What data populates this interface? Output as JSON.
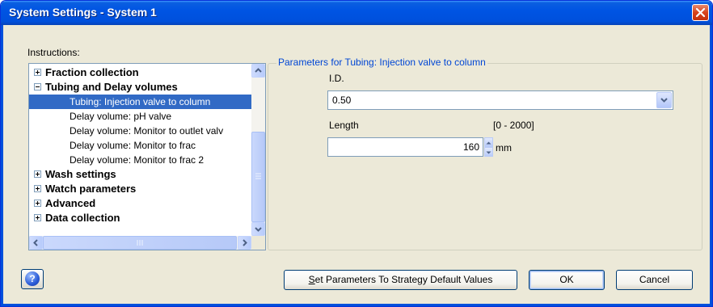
{
  "window": {
    "title": "System Settings - System 1"
  },
  "instructions_label": "Instructions:",
  "tree": {
    "items": [
      {
        "label": "Fraction collection",
        "level": 0,
        "toggle": "plus"
      },
      {
        "label": "Tubing and Delay volumes",
        "level": 0,
        "toggle": "minus"
      },
      {
        "label": "Tubing: Injection valve to column",
        "level": 1,
        "selected": true
      },
      {
        "label": "Delay volume: pH valve",
        "level": 1
      },
      {
        "label": "Delay volume: Monitor to outlet valv",
        "level": 1
      },
      {
        "label": "Delay volume: Monitor to frac",
        "level": 1
      },
      {
        "label": "Delay volume: Monitor to frac 2",
        "level": 1
      },
      {
        "label": "Wash settings",
        "level": 0,
        "toggle": "plus"
      },
      {
        "label": "Watch parameters",
        "level": 0,
        "toggle": "plus"
      },
      {
        "label": "Advanced",
        "level": 0,
        "toggle": "plus"
      },
      {
        "label": "Data collection",
        "level": 0,
        "toggle": "plus"
      }
    ]
  },
  "params": {
    "group_title": "Parameters for Tubing: Injection valve to column",
    "id_label": "I.D.",
    "id_value": "0.50",
    "length_label": "Length",
    "length_range": "[0 - 2000]",
    "length_value": "160",
    "length_unit": "mm"
  },
  "buttons": {
    "set_defaults_first": "S",
    "set_defaults_rest": "et Parameters To Strategy Default Values",
    "ok": "OK",
    "cancel": "Cancel",
    "help": "?"
  },
  "colors": {
    "titlebar": "#0054e3",
    "selection": "#316ac5",
    "group_title": "#0046d5",
    "dialog_bg": "#ece9d8"
  }
}
